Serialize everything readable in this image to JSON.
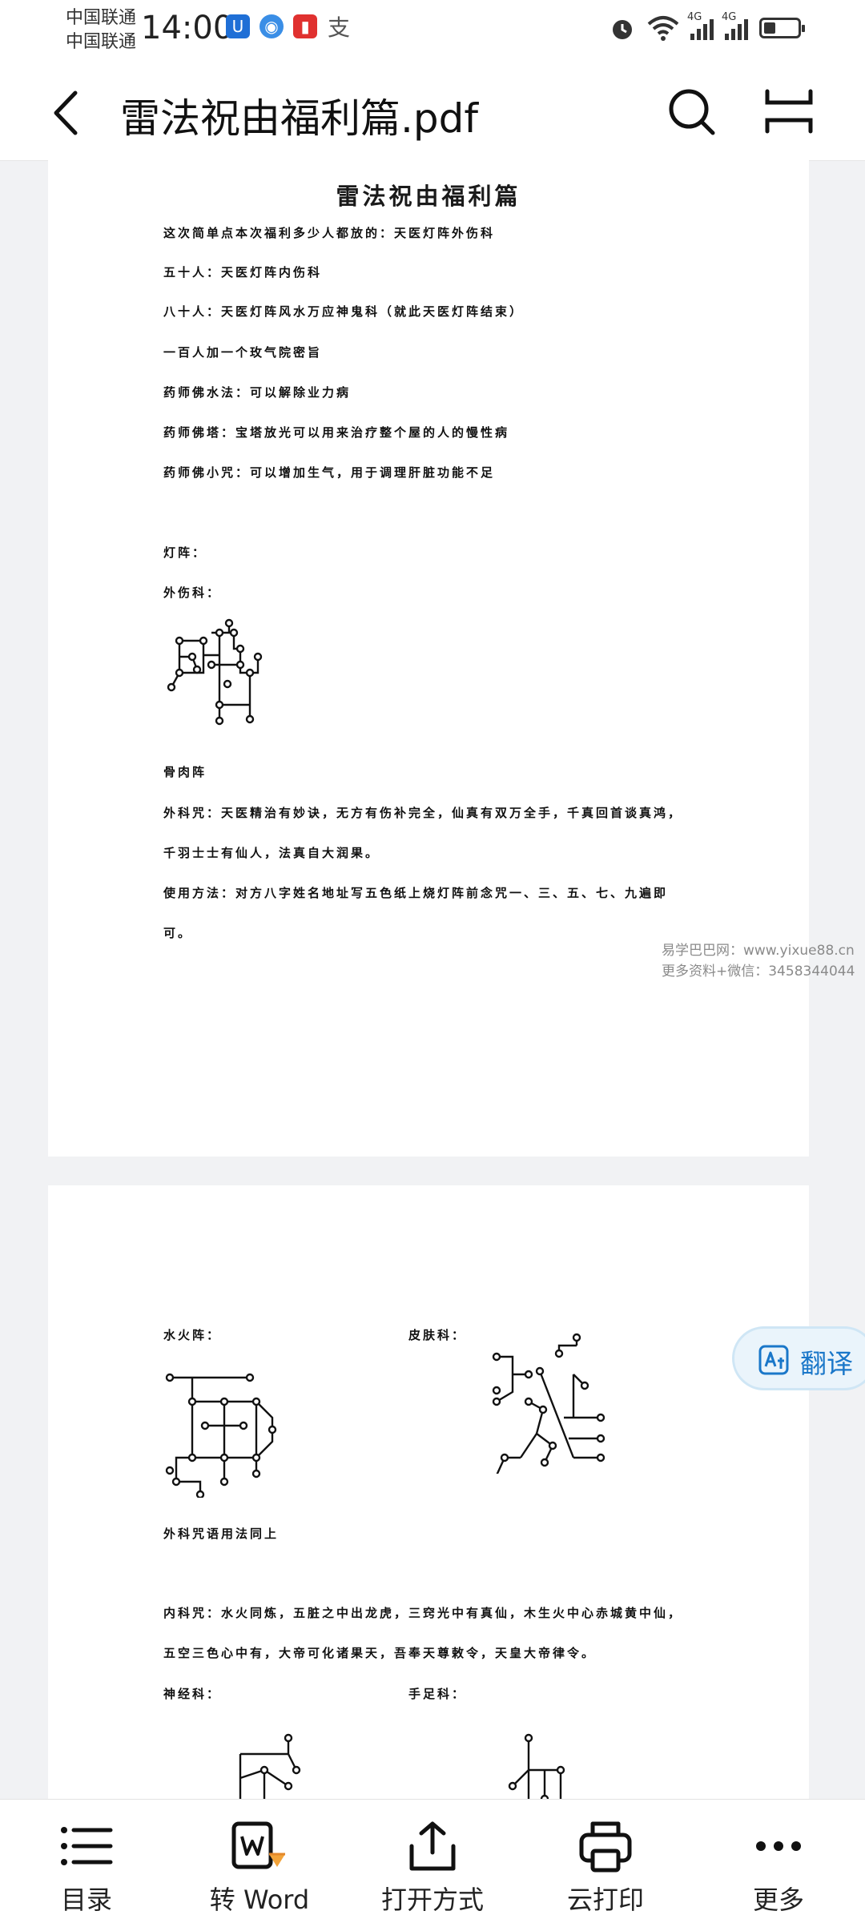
{
  "status_bar": {
    "carrier_1": "中国联通",
    "carrier_2": "中国联通",
    "time": "14:00",
    "network_1": "4G",
    "network_2": "4G"
  },
  "title_bar": {
    "title": "雷法祝由福利篇.pdf"
  },
  "document": {
    "page1": {
      "heading": "雷法祝由福利篇",
      "lines": [
        "这次简单点本次福利多少人都放的：天医灯阵外伤科",
        "五十人：天医灯阵内伤科",
        "八十人：天医灯阵风水万应神鬼科（就此天医灯阵结束）",
        "一百人加一个玫气院密旨",
        "药师佛水法：可以解除业力病",
        "药师佛塔：宝塔放光可以用来治疗整个屋的人的慢性病",
        "药师佛小咒：可以增加生气，用于调理肝脏功能不足"
      ],
      "label_lamp_array": "灯阵：",
      "label_external": "外伤科：",
      "label_bone_array": "骨肉阵",
      "body_lines": [
        "外科咒：天医精治有妙诀，无方有伤补完全，仙真有双万全手，千真回首谈真鸿，",
        "千羽士士有仙人，法真自大润果。",
        "使用方法：对方八字姓名地址写五色纸上烧灯阵前念咒一、三、五、七、九遍即",
        "可。"
      ]
    },
    "watermark": {
      "line_1": "易学巴巴网：www.yixue88.cn",
      "line_2": "更多资料+微信：3458344044"
    },
    "page2": {
      "label_water_fire": "水火阵：",
      "label_skin": "皮肤科：",
      "note_same_usage": "外科咒语用法同上",
      "body_lines": [
        "内科咒：水火同炼，五脏之中出龙虎，三窍光中有真仙，木生火中心赤城黄中仙，",
        "五空三色心中有，大帝可化诸果天，吾奉天尊敕令，天皇大帝律令。"
      ],
      "label_nerve": "神经科：",
      "label_hand_foot": "手足科："
    }
  },
  "translate_button": {
    "label": "翻译"
  },
  "toolbar": {
    "items": [
      {
        "label": "目录",
        "icon": "list-icon"
      },
      {
        "label": "转 Word",
        "icon": "convert-word-icon"
      },
      {
        "label": "打开方式",
        "icon": "share-open-icon"
      },
      {
        "label": "云打印",
        "icon": "printer-icon"
      },
      {
        "label": "更多",
        "icon": "more-icon"
      }
    ]
  },
  "colors": {
    "accent": "#1a77c9",
    "background": "#f1f2f4"
  }
}
